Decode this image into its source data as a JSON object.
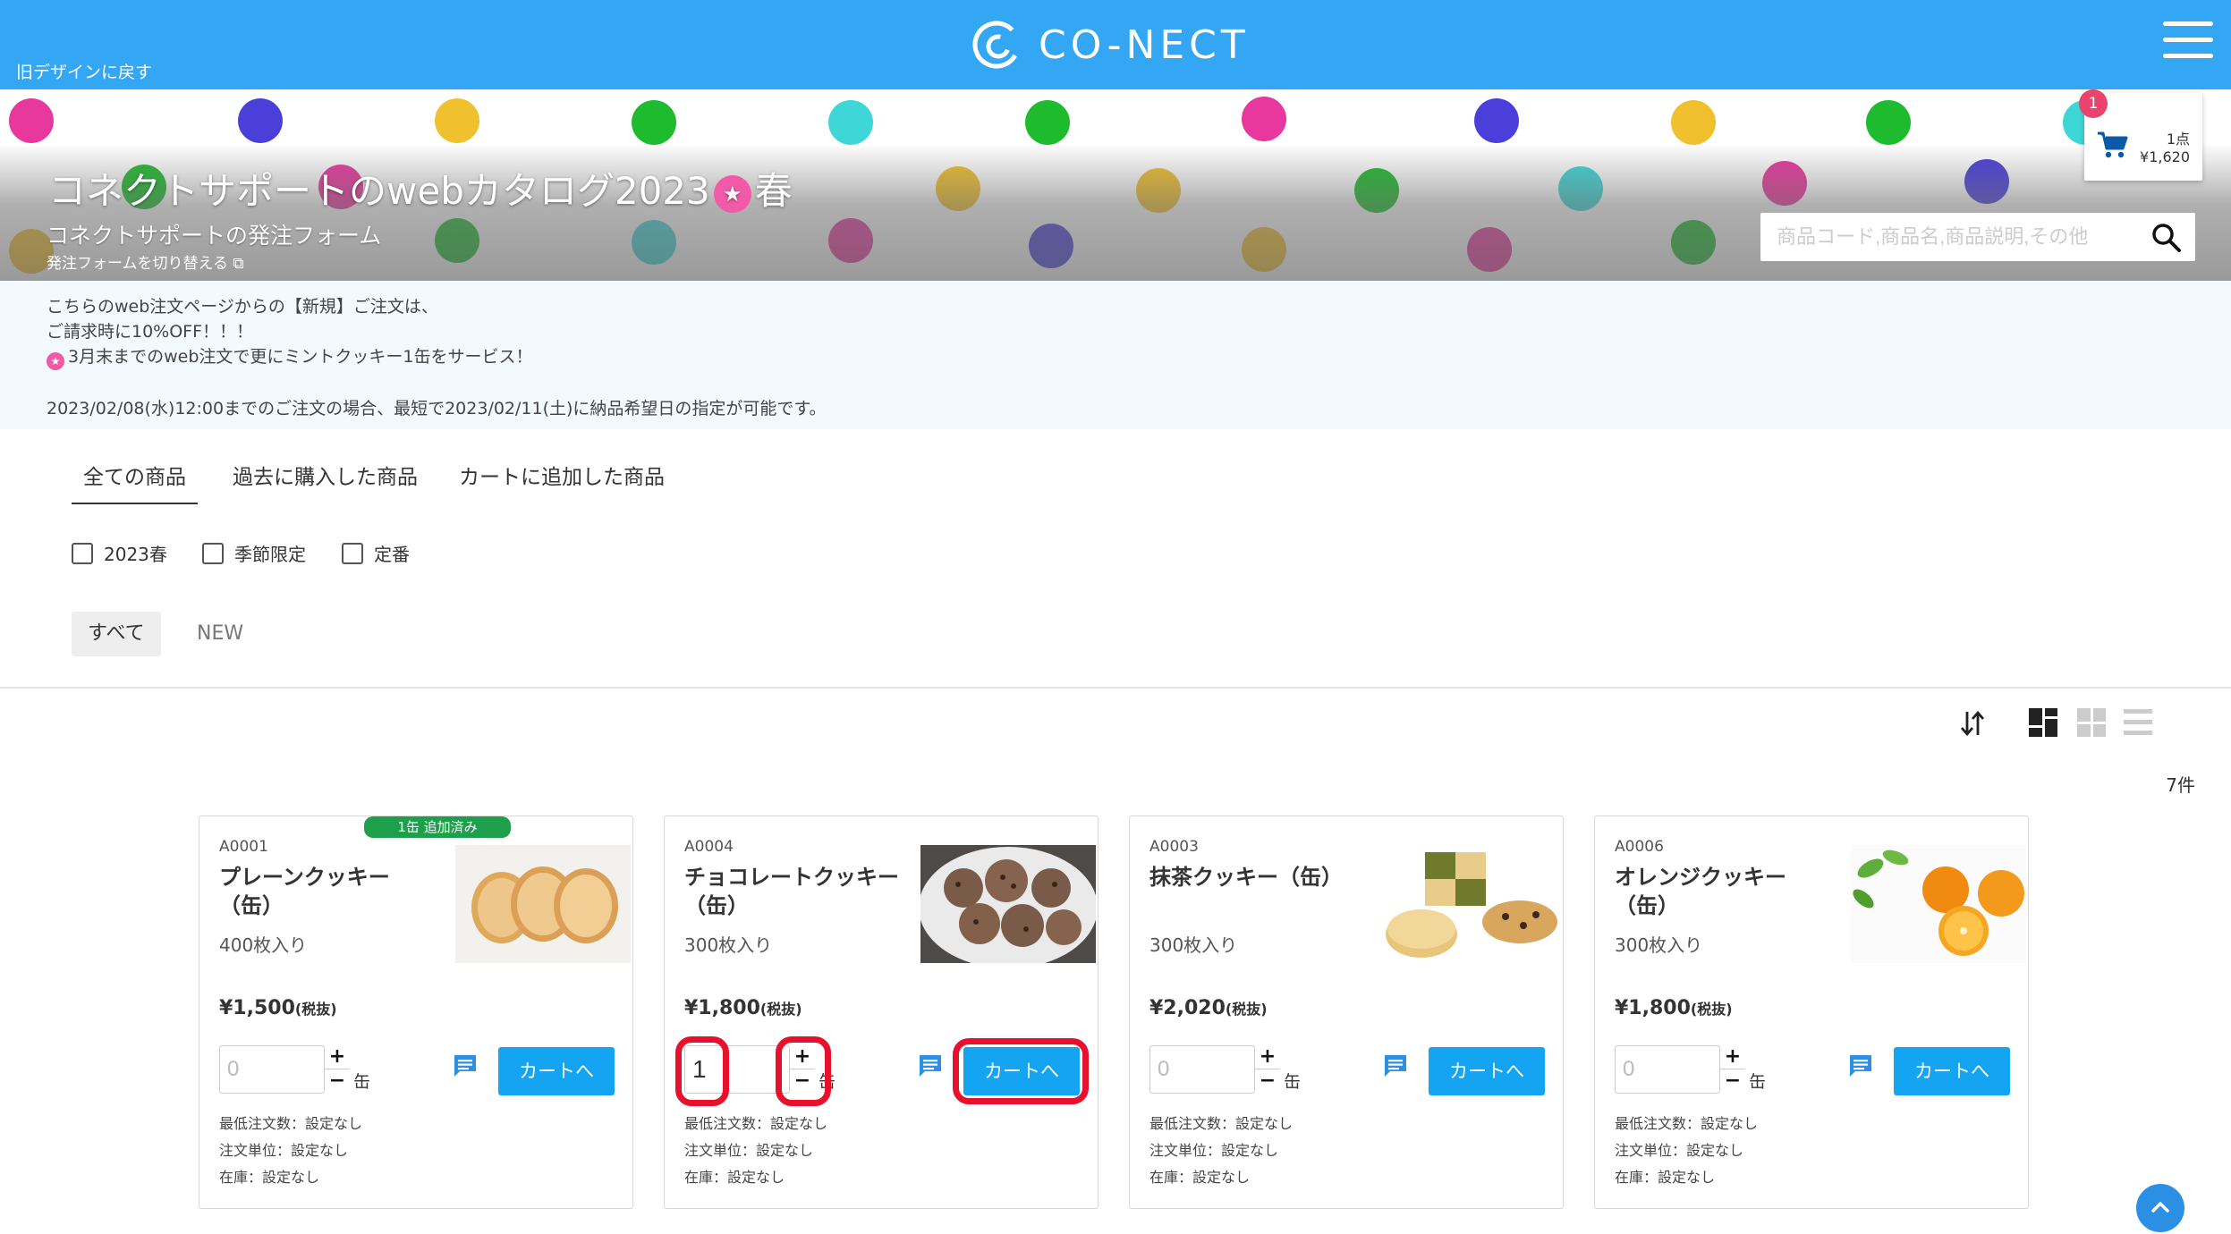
{
  "header": {
    "old_design_link": "旧デザインに戻す",
    "logo_text": "CO-NECT",
    "brand_color": "#33a6f4"
  },
  "banner": {
    "title_prefix": "コネクトサポートのwebカタログ2023",
    "title_suffix": "春",
    "subtitle": "コネクトサポートの発注フォーム",
    "switch_form_link": "発注フォームを切り替える",
    "search_placeholder": "商品コード,商品名,商品説明,その他"
  },
  "cart": {
    "badge": "1",
    "count": "1点",
    "total": "¥1,620"
  },
  "notice": {
    "line1": "こちらのweb注文ページからの【新規】ご注文は、",
    "line2": "ご請求時に10%OFF！！！",
    "line3": "3月末までのweb注文で更にミントクッキー1缶をサービス！",
    "line4": "2023/02/08(水)12:00までのご注文の場合、最短で2023/02/11(土)に納品希望日の指定が可能です。"
  },
  "tabs": [
    {
      "label": "全ての商品",
      "active": true
    },
    {
      "label": "過去に購入した商品",
      "active": false
    },
    {
      "label": "カートに追加した商品",
      "active": false
    }
  ],
  "filters": [
    {
      "label": "2023春",
      "checked": false
    },
    {
      "label": "季節限定",
      "checked": false
    },
    {
      "label": "定番",
      "checked": false
    }
  ],
  "chips": [
    {
      "label": "すべて",
      "active": true
    },
    {
      "label": "NEW",
      "active": false
    }
  ],
  "result_count": "7件",
  "products": [
    {
      "code": "A0001",
      "name": "プレーンクッキー（缶）",
      "desc": "400枚入り",
      "price": "¥1,500",
      "tax": "(税抜)",
      "qty": "",
      "qty_placeholder": "0",
      "unit": "缶",
      "badge": "1缶 追加済み",
      "image": "plain-cookie-image"
    },
    {
      "code": "A0004",
      "name": "チョコレートクッキー（缶）",
      "desc": "300枚入り",
      "price": "¥1,800",
      "tax": "(税抜)",
      "qty": "1",
      "qty_placeholder": "0",
      "unit": "缶",
      "badge": "",
      "image": "chocolate-cookie-image"
    },
    {
      "code": "A0003",
      "name": "抹茶クッキー（缶）",
      "desc": "300枚入り",
      "price": "¥2,020",
      "tax": "(税抜)",
      "qty": "",
      "qty_placeholder": "0",
      "unit": "缶",
      "badge": "",
      "image": "matcha-cookie-image"
    },
    {
      "code": "A0006",
      "name": "オレンジクッキー（缶）",
      "desc": "300枚入り",
      "price": "¥1,800",
      "tax": "(税抜)",
      "qty": "",
      "qty_placeholder": "0",
      "unit": "缶",
      "badge": "",
      "image": "orange-image"
    }
  ],
  "card_labels": {
    "cart_button": "カートへ",
    "min_order": "最低注文数：設定なし",
    "order_unit": "注文単位：設定なし",
    "stock": "在庫：設定なし"
  },
  "colors": {
    "cart_button": "#15a4f2",
    "added_badge": "#1e9f4b",
    "cart_badge": "#e9436e",
    "highlight": "#e8112d"
  }
}
